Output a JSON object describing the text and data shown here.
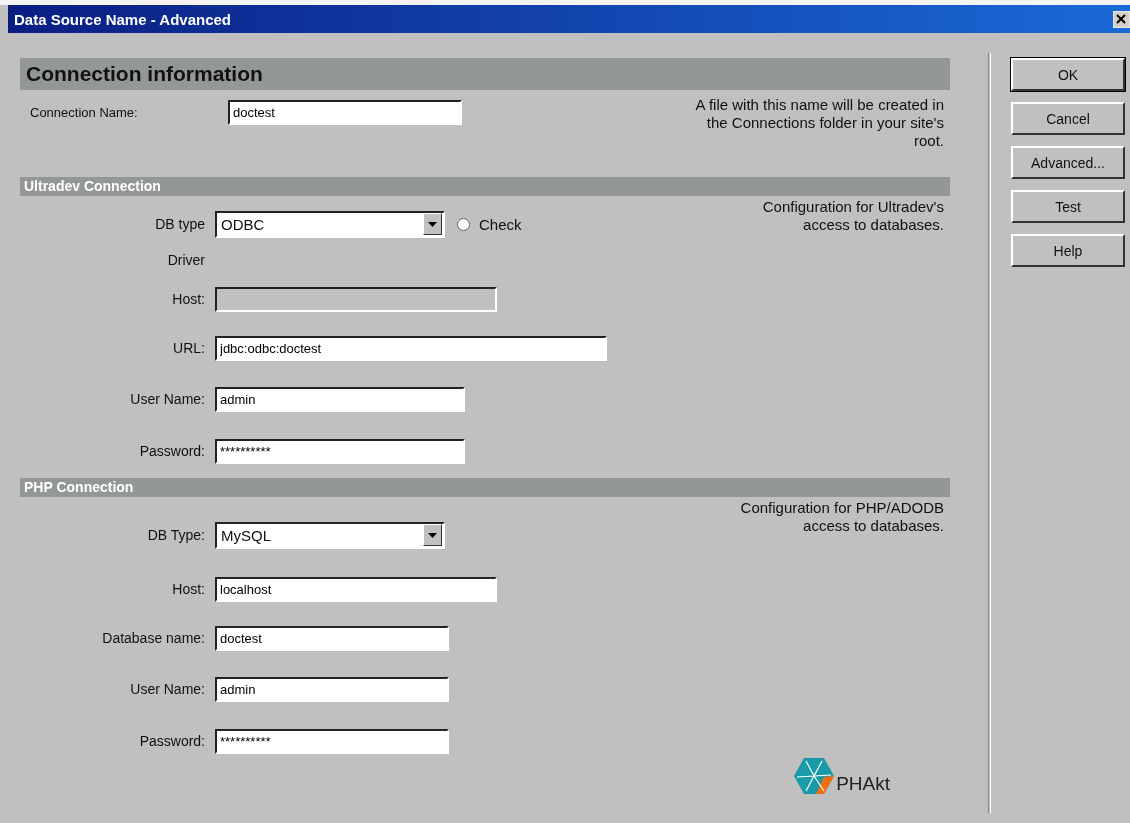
{
  "window": {
    "title": "Data Source Name - Advanced"
  },
  "connection": {
    "heading": "Connection information",
    "label": "Connection Name:",
    "value": "doctest",
    "note": "A file with this name will be created in the Connections folder in your site's root."
  },
  "sections": [
    {
      "heading": "Ultradev Connection",
      "note": [
        "Configuration for Ultradev's",
        "access to databases."
      ],
      "check": {
        "label": "Check",
        "checked": false
      },
      "fields": [
        {
          "kind": "select",
          "label": "DB type",
          "value": "ODBC"
        },
        {
          "kind": "label",
          "label": "Driver"
        },
        {
          "kind": "text",
          "label": "Host:",
          "disabled": true
        },
        {
          "kind": "text",
          "label": "URL:",
          "value": "jdbc:odbc:doctest",
          "disabled": false
        },
        {
          "kind": "text",
          "label": "User Name:",
          "value": "admin",
          "disabled": false
        },
        {
          "kind": "text",
          "label": "Password:",
          "value": "**********",
          "disabled": false
        }
      ]
    },
    {
      "heading": "PHP Connection",
      "note": [
        "Configuration for PHP/ADODB",
        "access to databases."
      ],
      "fields": [
        {
          "kind": "select",
          "label": "DB Type:",
          "value": "MySQL"
        },
        {
          "kind": "text",
          "label": "Host:",
          "value": "localhost",
          "disabled": false
        },
        {
          "kind": "text",
          "label": "Database name:",
          "value": "doctest",
          "disabled": false
        },
        {
          "kind": "text",
          "label": "User Name:",
          "value": "admin",
          "disabled": false
        },
        {
          "kind": "text",
          "label": "Password:",
          "value": "**********",
          "disabled": false
        }
      ]
    }
  ],
  "logo": {
    "text": "PHAkt"
  },
  "buttons": [
    {
      "label": "OK",
      "default": true
    },
    {
      "label": "Cancel",
      "default": false
    },
    {
      "label": "Advanced...",
      "default": false
    },
    {
      "label": "Test",
      "default": false
    },
    {
      "label": "Help",
      "default": false
    }
  ]
}
